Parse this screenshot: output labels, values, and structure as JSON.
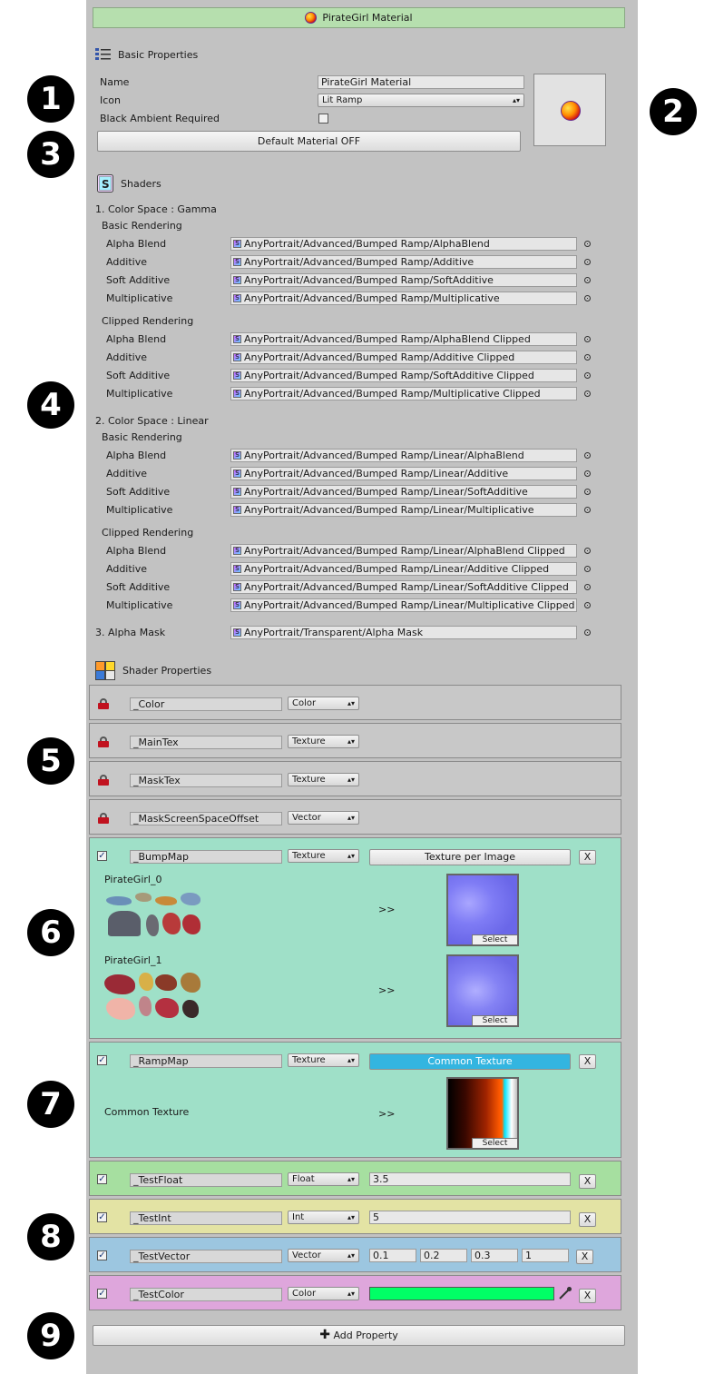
{
  "title": "PirateGirl Material",
  "badges": [
    "1",
    "2",
    "3",
    "4",
    "5",
    "6",
    "7",
    "8",
    "9"
  ],
  "basic": {
    "heading": "Basic Properties",
    "name_label": "Name",
    "name_value": "PirateGirl Material",
    "icon_label": "Icon",
    "icon_value": "Lit Ramp",
    "black_ambient_label": "Black Ambient Required",
    "default_btn": "Default Material OFF"
  },
  "shaders": {
    "heading": "Shaders",
    "gamma": "1. Color Space : Gamma",
    "linear": "2. Color Space : Linear",
    "basic_rendering": "Basic Rendering",
    "clipped_rendering": "Clipped Rendering",
    "row_labels": [
      "Alpha Blend",
      "Additive",
      "Soft Additive",
      "Multiplicative"
    ],
    "gamma_basic": [
      "AnyPortrait/Advanced/Bumped Ramp/AlphaBlend",
      "AnyPortrait/Advanced/Bumped Ramp/Additive",
      "AnyPortrait/Advanced/Bumped Ramp/SoftAdditive",
      "AnyPortrait/Advanced/Bumped Ramp/Multiplicative"
    ],
    "gamma_clipped": [
      "AnyPortrait/Advanced/Bumped Ramp/AlphaBlend Clipped",
      "AnyPortrait/Advanced/Bumped Ramp/Additive Clipped",
      "AnyPortrait/Advanced/Bumped Ramp/SoftAdditive Clipped",
      "AnyPortrait/Advanced/Bumped Ramp/Multiplicative Clipped"
    ],
    "linear_basic": [
      "AnyPortrait/Advanced/Bumped Ramp/Linear/AlphaBlend",
      "AnyPortrait/Advanced/Bumped Ramp/Linear/Additive",
      "AnyPortrait/Advanced/Bumped Ramp/Linear/SoftAdditive",
      "AnyPortrait/Advanced/Bumped Ramp/Linear/Multiplicative"
    ],
    "linear_clipped": [
      "AnyPortrait/Advanced/Bumped Ramp/Linear/AlphaBlend Clipped",
      "AnyPortrait/Advanced/Bumped Ramp/Linear/Additive Clipped",
      "AnyPortrait/Advanced/Bumped Ramp/Linear/SoftAdditive Clipped",
      "AnyPortrait/Advanced/Bumped Ramp/Linear/Multiplicative Clipped"
    ],
    "alpha_mask_label": "3. Alpha Mask",
    "alpha_mask_value": "AnyPortrait/Transparent/Alpha Mask"
  },
  "props": {
    "heading": "Shader Properties",
    "locked": [
      {
        "name": "_Color",
        "type": "Color"
      },
      {
        "name": "_MainTex",
        "type": "Texture"
      },
      {
        "name": "_MaskTex",
        "type": "Texture"
      },
      {
        "name": "_MaskScreenSpaceOffset",
        "type": "Vector"
      }
    ],
    "bump": {
      "name": "_BumpMap",
      "type": "Texture",
      "mode": "Texture per Image",
      "images": [
        "PirateGirl_0",
        "PirateGirl_1"
      ],
      "arrow": ">>",
      "select": "Select"
    },
    "ramp": {
      "name": "_RampMap",
      "type": "Texture",
      "mode": "Common Texture",
      "label": "Common Texture",
      "arrow": ">>",
      "select": "Select"
    },
    "float": {
      "name": "_TestFloat",
      "type": "Float",
      "value": "3.5"
    },
    "int": {
      "name": "_TestInt",
      "type": "Int",
      "value": "5"
    },
    "vector": {
      "name": "_TestVector",
      "type": "Vector",
      "x": "0.1",
      "y": "0.2",
      "z": "0.3",
      "w": "1"
    },
    "color": {
      "name": "_TestColor",
      "type": "Color",
      "value": "#00ff66"
    },
    "x": "X",
    "add_btn": "Add Property"
  },
  "colors": {
    "panel": "#c2c2c2",
    "title_bg": "#b6dfae",
    "teal_box": "#9fe0c8",
    "float_box": "#a6dfa0",
    "int_box": "#e3e3a4",
    "vector_box": "#9cc6e0",
    "color_box": "#dea6dc",
    "common_btn": "#33b5e0"
  }
}
